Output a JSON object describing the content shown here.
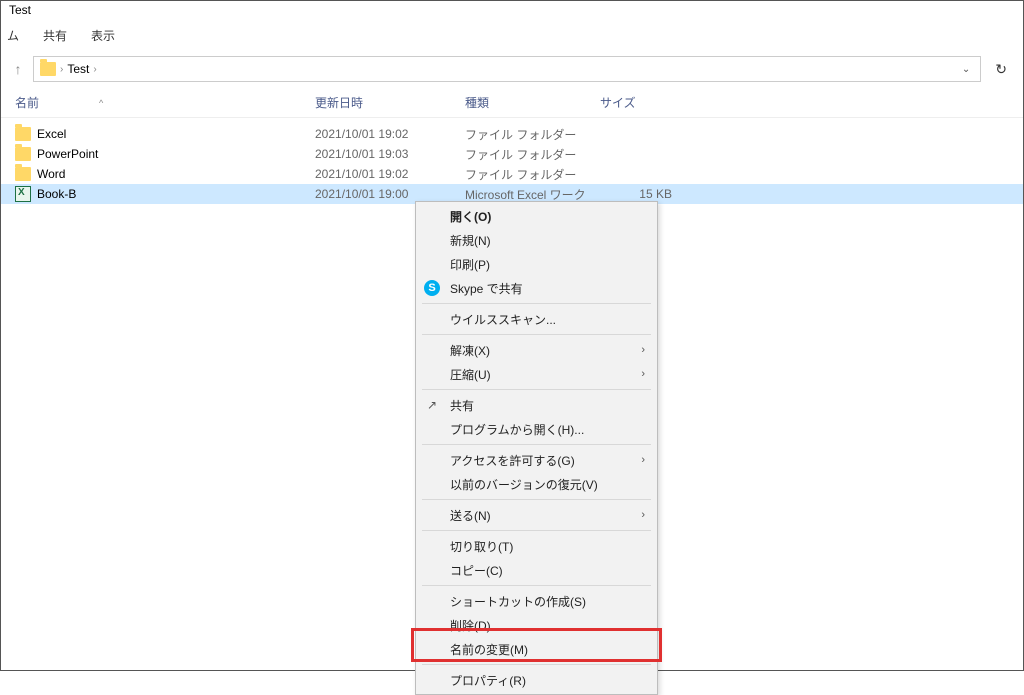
{
  "window": {
    "title": "Test"
  },
  "ribbon": {
    "tabs": [
      "ム",
      "共有",
      "表示"
    ]
  },
  "breadcrumb": {
    "segments": [
      "Test"
    ],
    "chevron": "›"
  },
  "columns": {
    "name": "名前",
    "date": "更新日時",
    "type": "種類",
    "size": "サイズ"
  },
  "rows": [
    {
      "icon": "folder",
      "name": "Excel",
      "date": "2021/10/01 19:02",
      "type": "ファイル フォルダー",
      "size": "",
      "selected": false
    },
    {
      "icon": "folder",
      "name": "PowerPoint",
      "date": "2021/10/01 19:03",
      "type": "ファイル フォルダー",
      "size": "",
      "selected": false
    },
    {
      "icon": "folder",
      "name": "Word",
      "date": "2021/10/01 19:02",
      "type": "ファイル フォルダー",
      "size": "",
      "selected": false
    },
    {
      "icon": "excel",
      "name": "Book-B",
      "date": "2021/10/01 19:00",
      "type": "Microsoft Excel ワーク",
      "size": "15 KB",
      "selected": true
    }
  ],
  "context_menu": [
    {
      "kind": "item",
      "label": "開く(O)",
      "bold": true
    },
    {
      "kind": "item",
      "label": "新規(N)"
    },
    {
      "kind": "item",
      "label": "印刷(P)"
    },
    {
      "kind": "item",
      "label": "Skype で共有",
      "icon": "skype"
    },
    {
      "kind": "sep"
    },
    {
      "kind": "item",
      "label": "ウイルススキャン..."
    },
    {
      "kind": "sep"
    },
    {
      "kind": "item",
      "label": "解凍(X)",
      "submenu": true
    },
    {
      "kind": "item",
      "label": "圧縮(U)",
      "submenu": true
    },
    {
      "kind": "sep"
    },
    {
      "kind": "item",
      "label": "共有",
      "icon": "share"
    },
    {
      "kind": "item",
      "label": "プログラムから開く(H)..."
    },
    {
      "kind": "sep"
    },
    {
      "kind": "item",
      "label": "アクセスを許可する(G)",
      "submenu": true
    },
    {
      "kind": "item",
      "label": "以前のバージョンの復元(V)"
    },
    {
      "kind": "sep"
    },
    {
      "kind": "item",
      "label": "送る(N)",
      "submenu": true
    },
    {
      "kind": "sep"
    },
    {
      "kind": "item",
      "label": "切り取り(T)"
    },
    {
      "kind": "item",
      "label": "コピー(C)"
    },
    {
      "kind": "sep"
    },
    {
      "kind": "item",
      "label": "ショートカットの作成(S)"
    },
    {
      "kind": "item",
      "label": "削除(D)"
    },
    {
      "kind": "item",
      "label": "名前の変更(M)"
    },
    {
      "kind": "sep"
    },
    {
      "kind": "item",
      "label": "プロパティ(R)"
    }
  ]
}
